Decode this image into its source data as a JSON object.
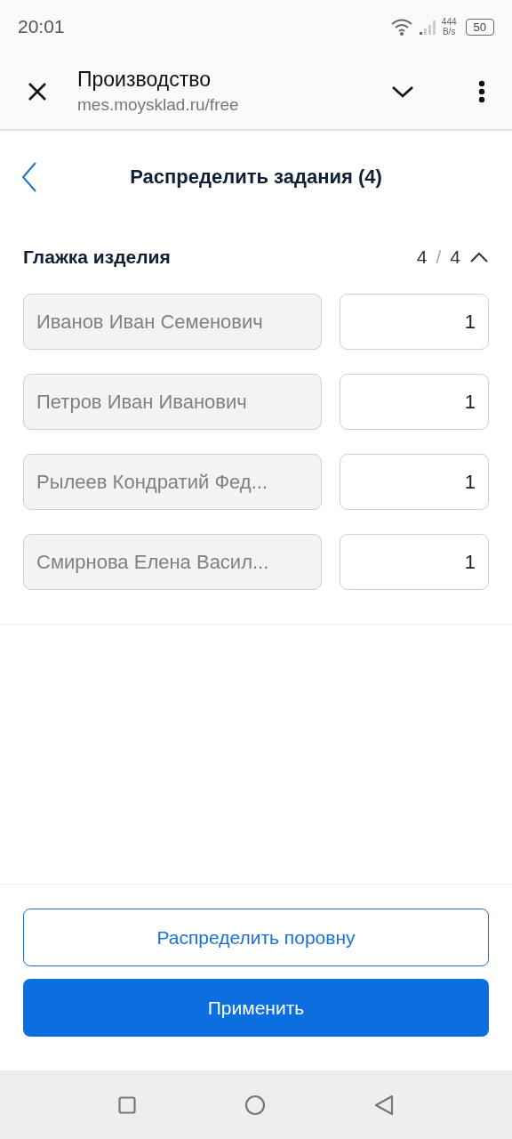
{
  "status_bar": {
    "time": "20:01",
    "speed": "444",
    "speed_unit": "B/s",
    "battery": "50"
  },
  "browser": {
    "title": "Производство",
    "url": "mes.moysklad.ru/free"
  },
  "header": {
    "title": "Распределить задания (4)"
  },
  "section": {
    "title": "Глажка изделия",
    "done": "4",
    "separator": "/",
    "total": "4",
    "expanded": true,
    "rows": [
      {
        "name": "Иванов Иван Семенович",
        "disabled": true,
        "quantity": "1"
      },
      {
        "name": "Петров Иван Иванович",
        "disabled": true,
        "quantity": "1"
      },
      {
        "name": "Рылеев Кондратий Фед...",
        "disabled": true,
        "quantity": "1"
      },
      {
        "name": "Смирнова Елена Васил...",
        "disabled": true,
        "quantity": "1"
      }
    ]
  },
  "buttons": [
    {
      "label": "Распределить поровну",
      "kind": "secondary"
    },
    {
      "label": "Применить",
      "kind": "primary"
    }
  ]
}
